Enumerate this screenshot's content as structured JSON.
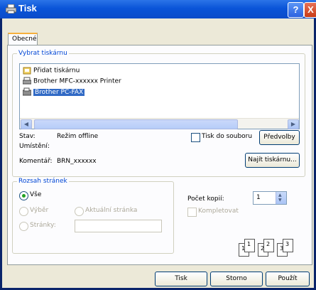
{
  "window": {
    "title": "Tisk",
    "help": "?",
    "close": "X"
  },
  "tab": {
    "label": "Obecné"
  },
  "printer_group": {
    "title": "Vybrat tiskárnu",
    "items": [
      {
        "label": "Přidat tiskárnu",
        "icon": "add-printer-icon"
      },
      {
        "label": "Brother MFC-xxxxxx  Printer",
        "icon": "printer-icon"
      },
      {
        "label": "Brother PC-FAX",
        "icon": "fax-icon",
        "selected": true
      }
    ],
    "status_label": "Stav:",
    "status_value": "Režim offline",
    "location_label": "Umístění:",
    "location_value": "",
    "comment_label": "Komentář:",
    "comment_value": "BRN_xxxxxx",
    "print_to_file": "Tisk do souboru",
    "preferences": "Předvolby",
    "find_printer": "Najít tiskárnu..."
  },
  "range_group": {
    "title": "Rozsah stránek",
    "all": "Vše",
    "selection": "Výběr",
    "current_page": "Aktuální stránka",
    "pages": "Stránky:",
    "pages_value": ""
  },
  "copies": {
    "label": "Počet kopií:",
    "value": "1",
    "collate": "Kompletovat",
    "page_nums": [
      "1",
      "1",
      "2",
      "2",
      "3",
      "3"
    ]
  },
  "buttons": {
    "print": "Tisk",
    "cancel": "Storno",
    "apply": "Použít"
  }
}
